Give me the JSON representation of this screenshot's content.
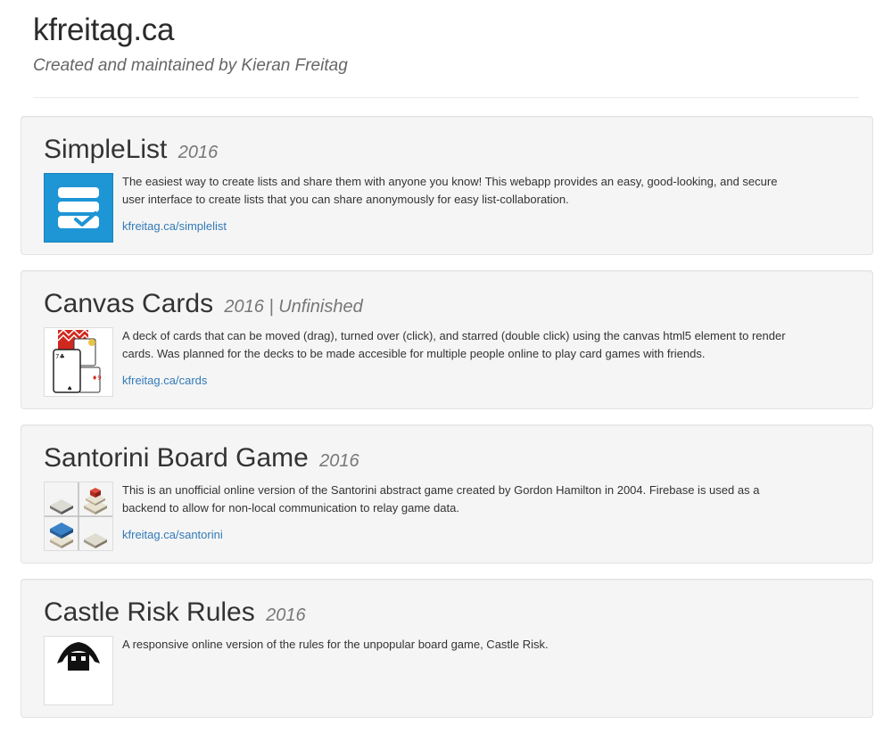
{
  "header": {
    "title": "kfreitag.ca",
    "subtitle": "Created and maintained by Kieran Freitag"
  },
  "projects": [
    {
      "name": "SimpleList",
      "meta": "2016",
      "description": "The easiest way to create lists and share them with anyone you know! This webapp provides an easy, good-looking, and secure user interface to create lists that you can share anonymously for easy list-collaboration.",
      "link": "kfreitag.ca/simplelist",
      "icon": "simplelist-logo-icon"
    },
    {
      "name": "Canvas Cards",
      "meta": "2016 | Unfinished",
      "description": "A deck of cards that can be moved (drag), turned over (click), and starred (double click) using the canvas html5 element to render cards. Was planned for the decks to be made accesible for multiple people online to play card games with friends.",
      "link": "kfreitag.ca/cards",
      "icon": "playing-cards-icon"
    },
    {
      "name": "Santorini Board Game",
      "meta": "2016",
      "description": "This is an unofficial online version of the Santorini abstract game created by Gordon Hamilton in 2004. Firebase is used as a backend to allow for non-local communication to relay game data.",
      "link": "kfreitag.ca/santorini",
      "icon": "santorini-board-icon"
    },
    {
      "name": "Castle Risk Rules",
      "meta": "2016",
      "description": "A responsive online version of the rules for the unpopular board game, Castle Risk.",
      "link": "",
      "icon": "castle-risk-logo-icon"
    }
  ],
  "colors": {
    "link": "#337ab7",
    "card_background": "#f5f5f5",
    "simplelist_blue": "#1e95d4"
  }
}
